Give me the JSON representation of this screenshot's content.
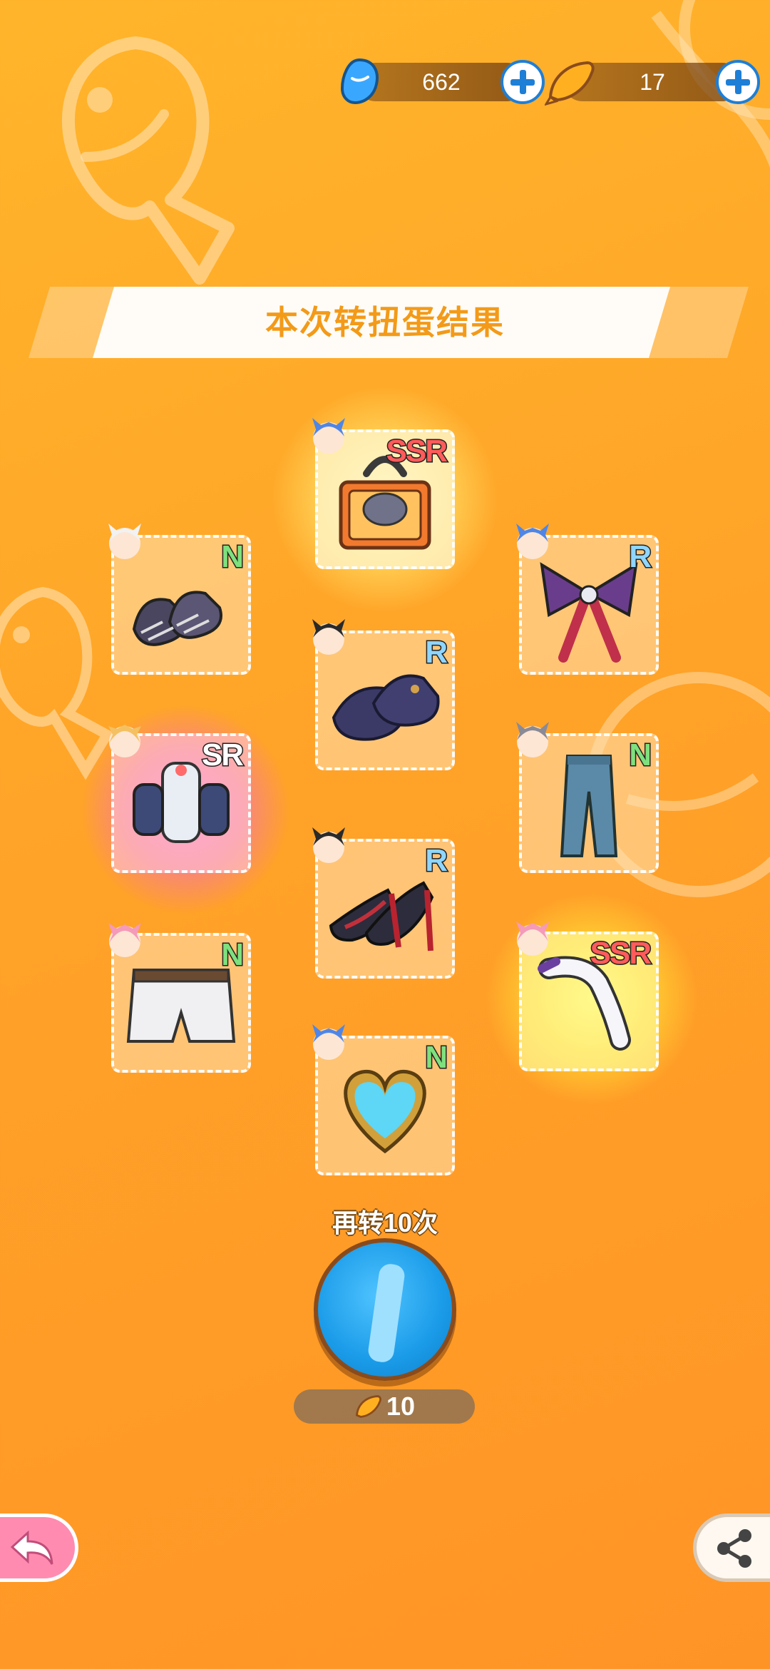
{
  "currency": {
    "gems": {
      "value": "662",
      "icon": "blue-gem-icon"
    },
    "fish": {
      "value": "17",
      "icon": "golden-fish-icon"
    }
  },
  "banner": {
    "title": "本次转扭蛋结果"
  },
  "results": [
    {
      "rarity": "SSR",
      "item": "treasure-chest",
      "character": "blue-cat"
    },
    {
      "rarity": "N",
      "item": "plaid-shoes",
      "character": "white-cat"
    },
    {
      "rarity": "R",
      "item": "striped-bow",
      "character": "blue-cat"
    },
    {
      "rarity": "R",
      "item": "navy-mary-janes",
      "character": "black-cat"
    },
    {
      "rarity": "SR",
      "item": "robot-outfit",
      "character": "blonde-girl"
    },
    {
      "rarity": "N",
      "item": "blue-jeans",
      "character": "gray-cat"
    },
    {
      "rarity": "R",
      "item": "red-heels",
      "character": "black-cat"
    },
    {
      "rarity": "N",
      "item": "white-shorts",
      "character": "pink-cat"
    },
    {
      "rarity": "SSR",
      "item": "white-horn",
      "character": "pink-cat"
    },
    {
      "rarity": "N",
      "item": "heart-gem",
      "character": "blue-cat"
    }
  ],
  "spin_again": {
    "label": "再转10次",
    "cost": "10"
  },
  "colors": {
    "background": "#ffa328",
    "banner_text": "#f39a18",
    "button": "#1a9be8"
  }
}
